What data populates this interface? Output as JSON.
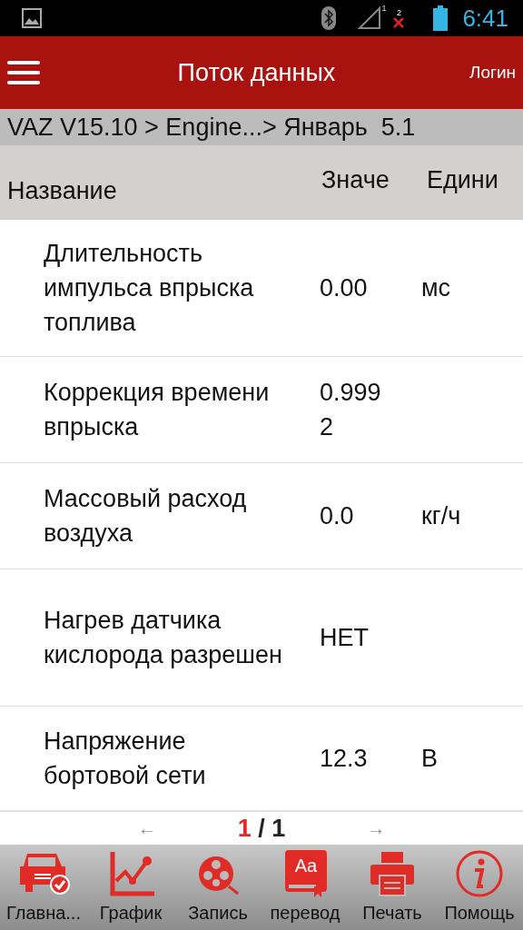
{
  "status_bar": {
    "time": "6:41",
    "sim1": "1",
    "sim2": "2"
  },
  "header": {
    "title": "Поток данных",
    "login": "Логин"
  },
  "breadcrumb": "VAZ V15.10 > Engine...> Январь  5.1",
  "columns": [
    "Название",
    "Значе",
    "Едини"
  ],
  "rows": [
    {
      "name": "Длительность импульса впрыска топлива",
      "value": "0.00",
      "unit": "мс"
    },
    {
      "name": "Коррекция времени впрыска",
      "value": "0.9992"
    },
    {
      "name": "Массовый расход воздуха",
      "value": "0.0",
      "unit": "кг/ч"
    },
    {
      "name": "Нагрев датчика кислорода разрешен",
      "value": "НЕТ"
    },
    {
      "name": "Напряжение бортовой сети",
      "value": "12.3",
      "unit": "В"
    }
  ],
  "pager": {
    "prev": "←",
    "current": "1",
    "total": "/ 1",
    "next": "→"
  },
  "toolbar": [
    {
      "kind": "car",
      "label": "Главна..."
    },
    {
      "kind": "graph",
      "label": "График"
    },
    {
      "kind": "record",
      "label": "Запись"
    },
    {
      "kind": "translate",
      "label": "перевод",
      "icon_text": "Aa"
    },
    {
      "kind": "print",
      "label": "Печать"
    },
    {
      "kind": "help",
      "label": "Помощь"
    }
  ]
}
